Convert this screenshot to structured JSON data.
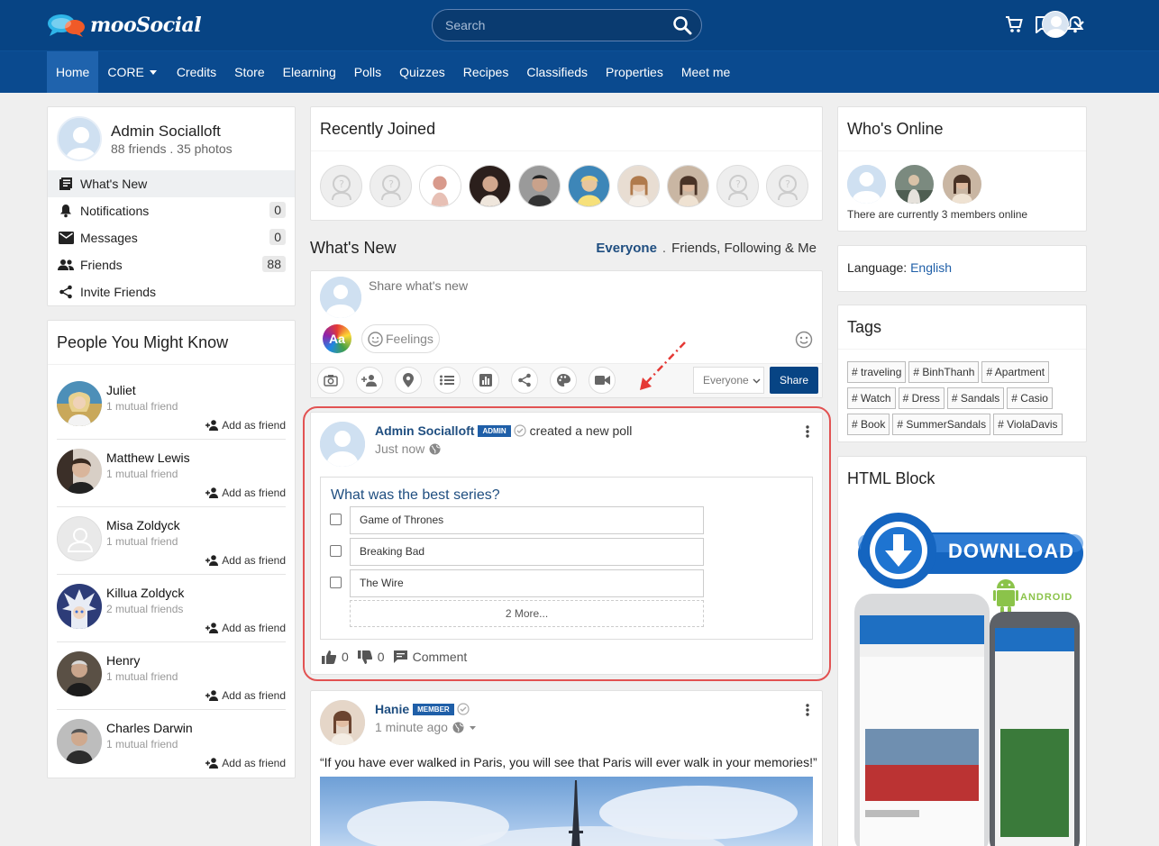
{
  "header": {
    "logo_text": "mooSocial",
    "search_placeholder": "Search",
    "brand_color": "#074484"
  },
  "nav": {
    "items": [
      "Home",
      "CORE",
      "Credits",
      "Store",
      "Elearning",
      "Polls",
      "Quizzes",
      "Recipes",
      "Classifieds",
      "Properties",
      "Meet me"
    ]
  },
  "profile": {
    "name": "Admin Socialloft",
    "stats": "88 friends . 35 photos",
    "menu": [
      {
        "label": "What's New",
        "icon": "newsfeed-icon",
        "count": ""
      },
      {
        "label": "Notifications",
        "icon": "bell-icon",
        "count": "0"
      },
      {
        "label": "Messages",
        "icon": "envelope-icon",
        "count": "0"
      },
      {
        "label": "Friends",
        "icon": "friends-icon",
        "count": "88"
      },
      {
        "label": "Invite Friends",
        "icon": "share-icon",
        "count": ""
      }
    ]
  },
  "pymk": {
    "title": "People You Might Know",
    "add_label": "Add as friend",
    "people": [
      {
        "name": "Juliet",
        "mutual": "1 mutual friend"
      },
      {
        "name": "Matthew Lewis",
        "mutual": "1 mutual friend"
      },
      {
        "name": "Misa Zoldyck",
        "mutual": "1 mutual friend"
      },
      {
        "name": "Killua Zoldyck",
        "mutual": "2 mutual friends"
      },
      {
        "name": "Henry",
        "mutual": "1 mutual friend"
      },
      {
        "name": "Charles Darwin",
        "mutual": "1 mutual friend"
      }
    ]
  },
  "recently_joined": {
    "title": "Recently Joined"
  },
  "whats_new": {
    "title": "What's New",
    "filter_everyone": "Everyone",
    "filter_sep": ".",
    "filter_friends": "Friends, Following & Me"
  },
  "composer": {
    "placeholder": "Share what's new",
    "font_label": "Aa",
    "feelings_label": "Feelings",
    "privacy": "Everyone",
    "share_label": "Share"
  },
  "poll_post": {
    "author": "Admin Socialloft",
    "role": "ADMIN",
    "action": "created a new poll",
    "time": "Just now",
    "question": "What was the best series?",
    "options": [
      "Game of Thrones",
      "Breaking Bad",
      "The Wire"
    ],
    "more": "2 More...",
    "likes": "0",
    "dislikes": "0",
    "comment_label": "Comment"
  },
  "photo_post": {
    "author": "Hanie",
    "role": "MEMBER",
    "time": "1 minute ago",
    "text": "“If you have ever walked in Paris, you will see that Paris will ever walk in your memories!”"
  },
  "whos_online": {
    "title": "Who's Online",
    "text": "There are currently 3 members online"
  },
  "language": {
    "label": "Language:",
    "value": "English"
  },
  "tags": {
    "title": "Tags",
    "items": [
      "# traveling",
      "# BinhThanh",
      "# Apartment",
      "# Watch",
      "# Dress",
      "# Sandals",
      "# Casio",
      "# Book",
      "# SummerSandals",
      "# ViolaDavis"
    ]
  },
  "html_block": {
    "title": "HTML Block",
    "download_text": "DOWNLOAD",
    "android_text": "ANDROID"
  }
}
